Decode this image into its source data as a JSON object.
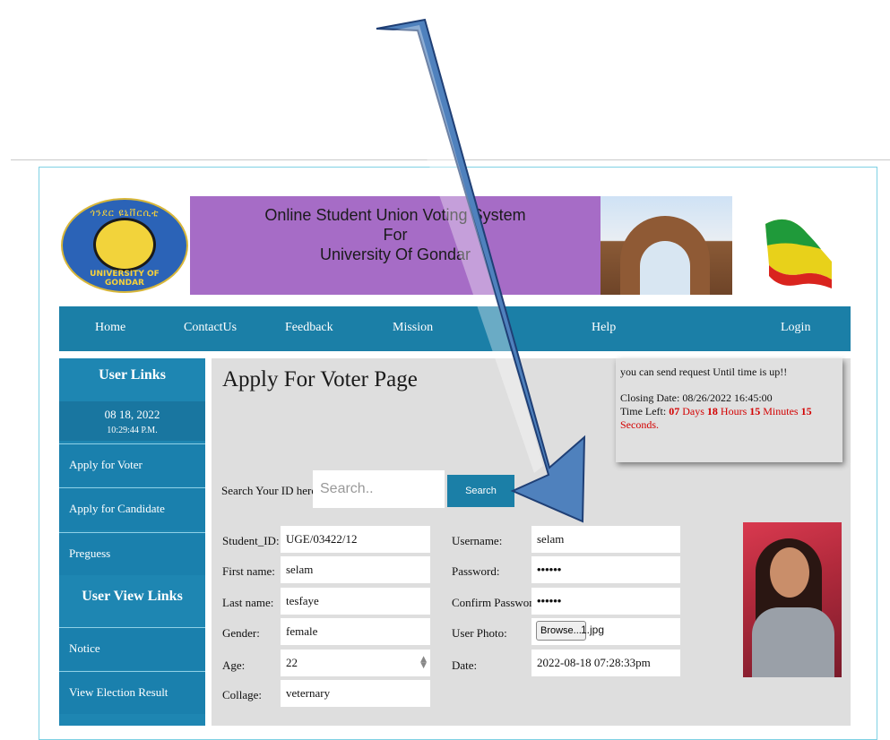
{
  "header": {
    "logo_top_text": "ጎንደር ዩኒቨርሲቲ",
    "logo_bottom_text": "UNIVERSITY OF GONDAR",
    "title_line1": "Online Student Union Voting System",
    "title_line2": "For",
    "title_line3": "University Of Gondar"
  },
  "nav": {
    "items": [
      {
        "label": "Home"
      },
      {
        "label": "ContactUs"
      },
      {
        "label": "Feedback"
      },
      {
        "label": "Mission"
      },
      {
        "label": "Help"
      },
      {
        "label": "Login"
      }
    ]
  },
  "sidebar": {
    "user_links_title": "User Links",
    "date": "08 18, 2022",
    "time": "10:29:44 P.M.",
    "links": [
      {
        "label": "Apply for Voter"
      },
      {
        "label": "Apply for Candidate"
      },
      {
        "label": "Preguess"
      }
    ],
    "view_links_title": "User View Links",
    "view_links": [
      {
        "label": "Notice"
      },
      {
        "label": "View Election Result"
      }
    ]
  },
  "main": {
    "page_title": "Apply For Voter Page",
    "notice": {
      "line1": "you can send request Until time is up!!",
      "closing_label": "Closing Date: ",
      "closing_value": "08/26/2022 16:45:00",
      "time_left_label": "Time Left: ",
      "days_num": "07",
      "days_word": " Days ",
      "hours_num": "18",
      "hours_word": " Hours ",
      "minutes_num": "15",
      "minutes_word": " Minutes ",
      "seconds_num": "15",
      "seconds_word": "Seconds."
    },
    "search": {
      "label": "Search Your ID here",
      "placeholder": "Search..",
      "button_label": "Search"
    },
    "form": {
      "student_id_label": "Student_ID:",
      "student_id_value": "UGE/03422/12",
      "first_name_label": "First name:",
      "first_name_value": "selam",
      "last_name_label": "Last name:",
      "last_name_value": "tesfaye",
      "gender_label": "Gender:",
      "gender_value": "female",
      "age_label": "Age:",
      "age_value": "22",
      "collage_label": "Collage:",
      "collage_value": "veternary",
      "username_label": "Username:",
      "username_value": "selam",
      "password_label": "Password:",
      "password_value": "••••••",
      "confirm_password_label": "Confirm Password:",
      "confirm_password_value": "••••••",
      "user_photo_label": "User Photo:",
      "browse_label": "Browse...",
      "file_name": "1.jpg",
      "date_label": "Date:",
      "date_value": "2022-08-18 07:28:33pm"
    }
  },
  "colors": {
    "nav_bg": "#1b7fa7",
    "sidebar_bg": "#1e86b2",
    "title_banner_bg": "#a66cc6",
    "arrow_fill": "#4f81bd",
    "countdown_red": "#d30000"
  }
}
